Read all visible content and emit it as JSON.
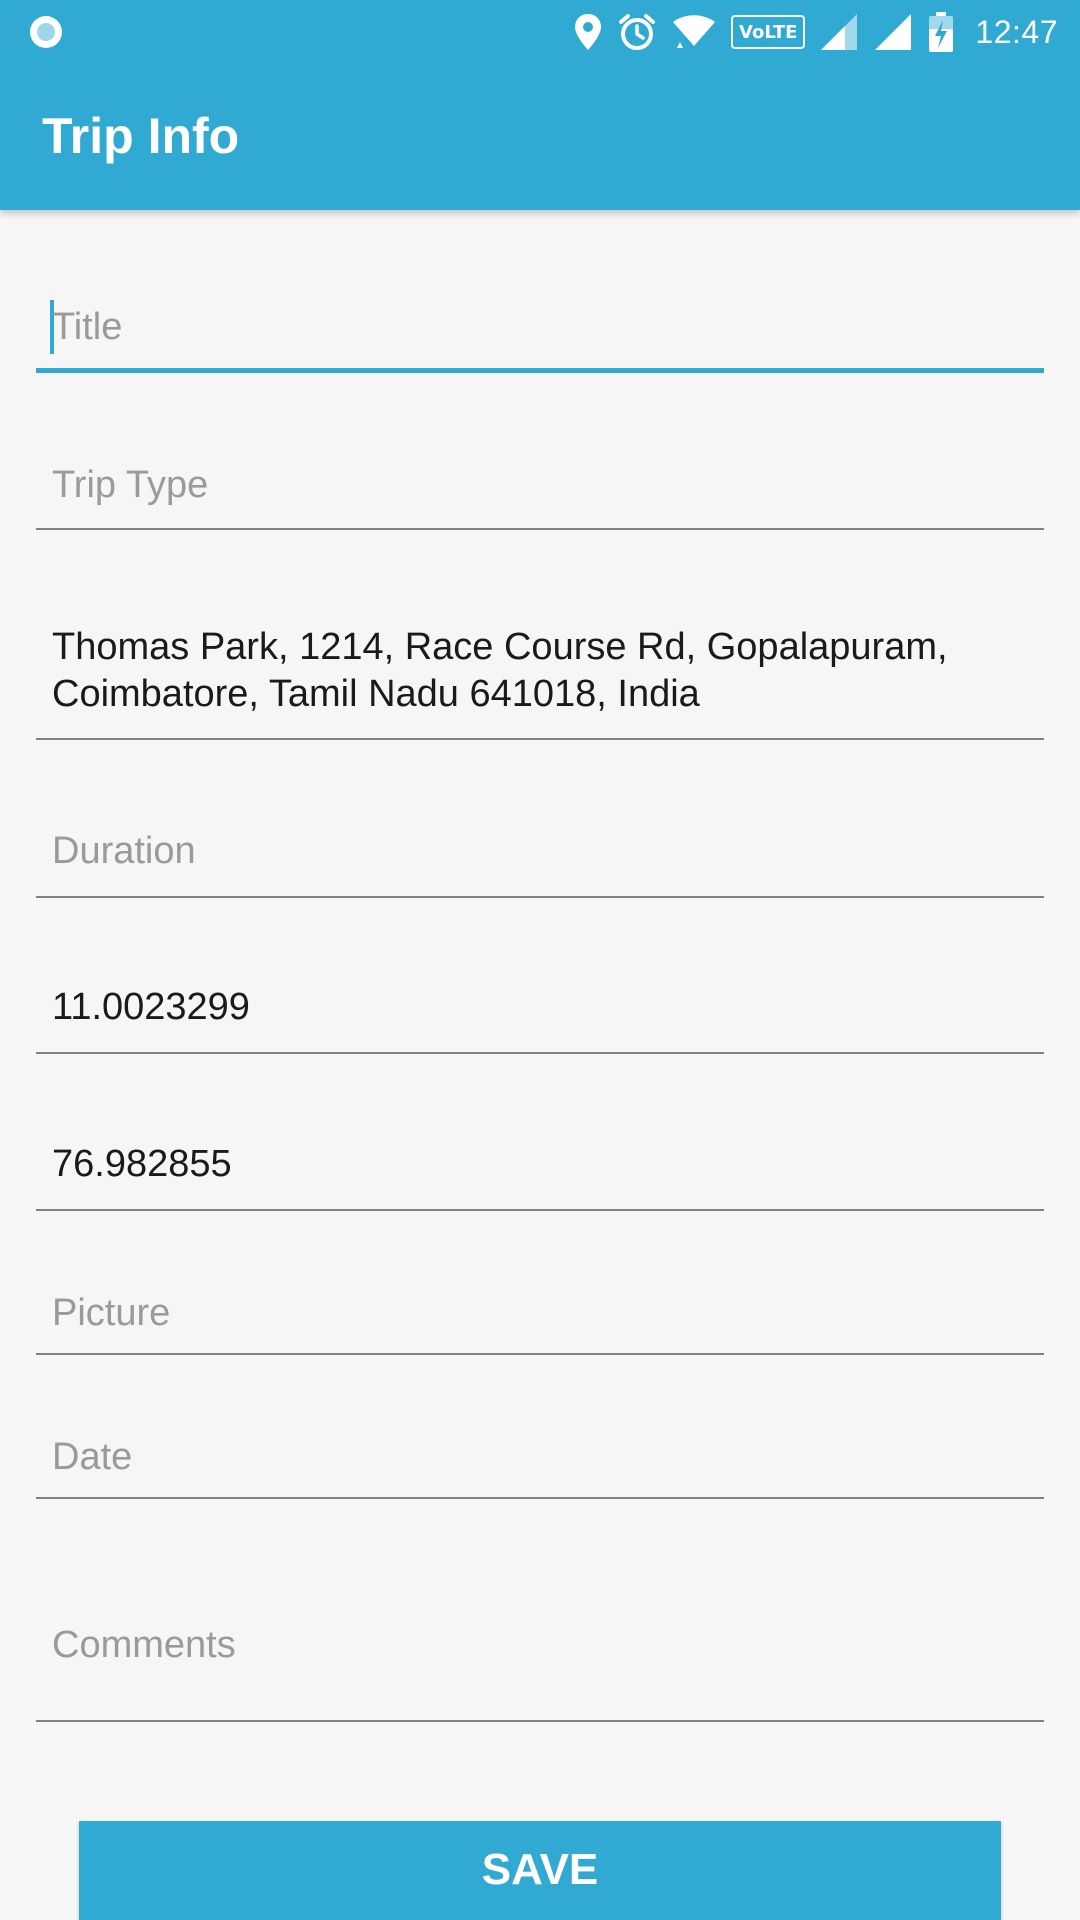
{
  "status_bar": {
    "time": "12:47",
    "network_badge": "VoLTE",
    "icons": [
      "notification-dot-icon",
      "location-icon",
      "alarm-icon",
      "wifi-icon",
      "volte-icon",
      "signal-icon",
      "signal-icon",
      "battery-charging-icon"
    ]
  },
  "app_bar": {
    "title": "Trip Info"
  },
  "form": {
    "title": {
      "placeholder": "Title",
      "value": ""
    },
    "trip_type": {
      "placeholder": "Trip Type",
      "value": ""
    },
    "address": {
      "value": "Thomas Park, 1214, Race Course Rd, Gopalapuram, Coimbatore, Tamil Nadu 641018, India"
    },
    "duration": {
      "placeholder": "Duration",
      "value": ""
    },
    "latitude": {
      "value": "11.0023299"
    },
    "longitude": {
      "value": "76.982855"
    },
    "picture": {
      "placeholder": "Picture",
      "value": ""
    },
    "date": {
      "placeholder": "Date",
      "value": ""
    },
    "comments": {
      "placeholder": "Comments",
      "value": ""
    }
  },
  "actions": {
    "save_label": "SAVE"
  },
  "colors": {
    "primary": "#30aad2",
    "background": "#f6f6f6",
    "hint_text": "#9a9a9a",
    "value_text": "#1a1a1a",
    "underline": "#808080"
  }
}
